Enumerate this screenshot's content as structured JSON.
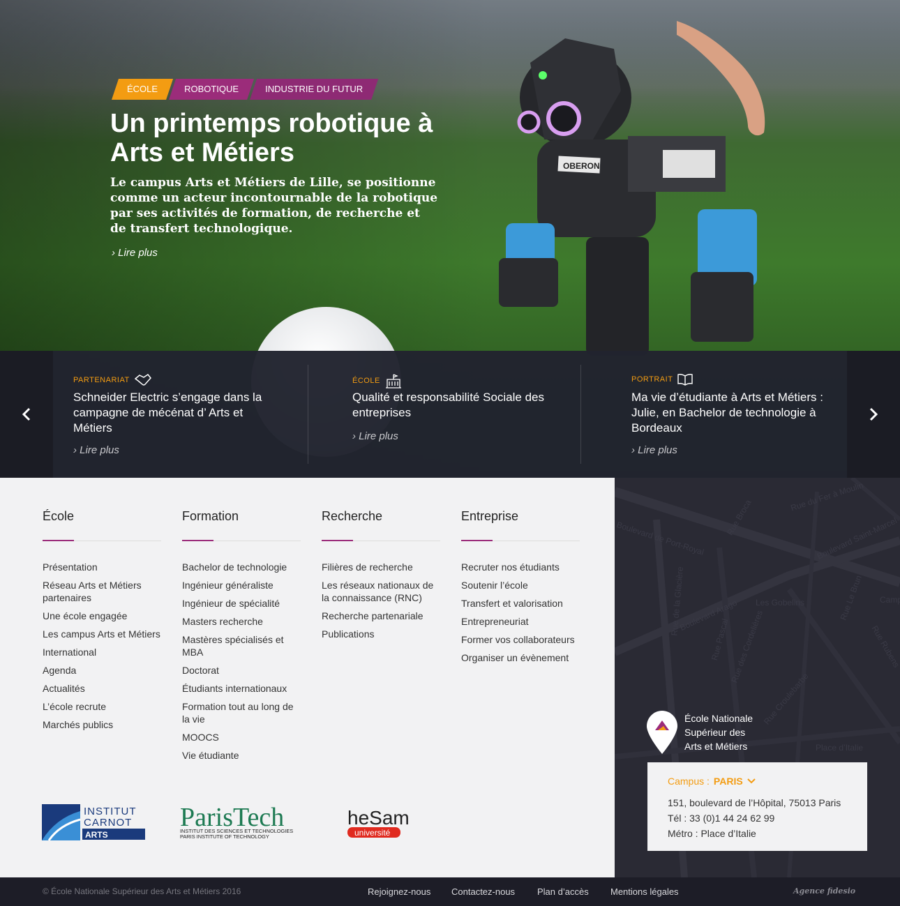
{
  "hero": {
    "tags": [
      "ÉCOLE",
      "ROBOTIQUE",
      "INDUSTRIE DU FUTUR"
    ],
    "title": "Un printemps robotique à Arts et Métiers",
    "description": "Le campus Arts et Métiers de Lille, se positionne comme un acteur incontournable de la robotique par ses activités de formation, de recherche et de transfert technologique.",
    "read_more": "Lire plus",
    "robot_label": "OBERON"
  },
  "news": {
    "prev_icon": "chevron-left-icon",
    "next_icon": "chevron-right-icon",
    "items": [
      {
        "category": "PARTENARIAT",
        "icon": "handshake-icon",
        "title": "Schneider Electric s’engage dans la campagne de mécénat d’ Arts et Métiers",
        "read_more": "Lire plus"
      },
      {
        "category": "ÉCOLE",
        "icon": "building-icon",
        "title": "Qualité et responsabilité Sociale des entreprises",
        "read_more": "Lire plus"
      },
      {
        "category": "PORTRAIT",
        "icon": "book-icon",
        "title": "Ma vie d’étudiante à Arts et Métiers : Julie, en Bachelor de technologie à Bordeaux",
        "read_more": "Lire plus"
      }
    ]
  },
  "menu": {
    "columns": [
      {
        "title": "École",
        "links": [
          "Présentation",
          "Réseau Arts et Métiers partenaires",
          "Une école engagée",
          "Les campus Arts et Métiers",
          "International",
          "Agenda",
          "Actualités",
          "L’école recrute",
          "Marchés publics"
        ]
      },
      {
        "title": "Formation",
        "links": [
          "Bachelor de technologie",
          "Ingénieur généraliste",
          "Ingénieur de spécialité",
          "Masters recherche",
          "Mastères spécialisés et MBA",
          "Doctorat",
          "Étudiants internationaux",
          "Formation tout au long de la vie",
          "MOOCS",
          "Vie étudiante"
        ]
      },
      {
        "title": "Recherche",
        "links": [
          "Filières de recherche",
          "Les réseaux nationaux de la connaissance (RNC)",
          "Recherche partenariale",
          "Publications"
        ]
      },
      {
        "title": "Entreprise",
        "links": [
          "Recruter nos étudiants",
          "Soutenir l’école",
          "Transfert et valorisation",
          "Entrepreneuriat",
          "Former vos collaborateurs",
          "Organiser un évènement"
        ]
      }
    ],
    "accent_color": "#9b2c7a"
  },
  "logos": {
    "carnot": {
      "line1": "INSTITUT",
      "line2": "CARNOT",
      "line3": "ARTS"
    },
    "paristech": {
      "name": "ParisTech",
      "sub1": "INSTITUT DES SCIENCES ET TECHNOLOGIES",
      "sub2": "PARIS INSTITUTE OF TECHNOLOGY"
    },
    "hesam": {
      "name": "heSam",
      "sub": "université"
    }
  },
  "map": {
    "streets": [
      "Rue du Fer à Moulin",
      "Rue Broca",
      "Boulevard de Port-Royal",
      "Boulevard Saint-Marcel",
      "Boulevard Arago",
      "Les Gobelins",
      "Rue de la Glacière",
      "Rue Pascal",
      "Rue des Cordelières",
      "Campo",
      "Rue Rubens",
      "Rue Le Brun",
      "Rue Croulebarbe",
      "Place d’Italie"
    ],
    "school_name": "École Nationale Supérieur des Arts et Métiers",
    "campus_label": "Campus :",
    "campus_value": "PARIS",
    "address": "151, boulevard de l’Hôpital, 75013 Paris",
    "phone": "Tél : 33 (0)1 44 24 62 99",
    "metro": "Métro : Place d’Italie"
  },
  "bottom": {
    "copyright": "© École Nationale Supérieur des Arts et Métiers 2016",
    "links": [
      "Rejoignez-nous",
      "Contactez-nous",
      "Plan d’accès",
      "Mentions légales"
    ],
    "agency": "Agence fidesio"
  },
  "colors": {
    "orange": "#f39c12",
    "purple": "#9b2c7a",
    "dark": "#1d1d27"
  }
}
